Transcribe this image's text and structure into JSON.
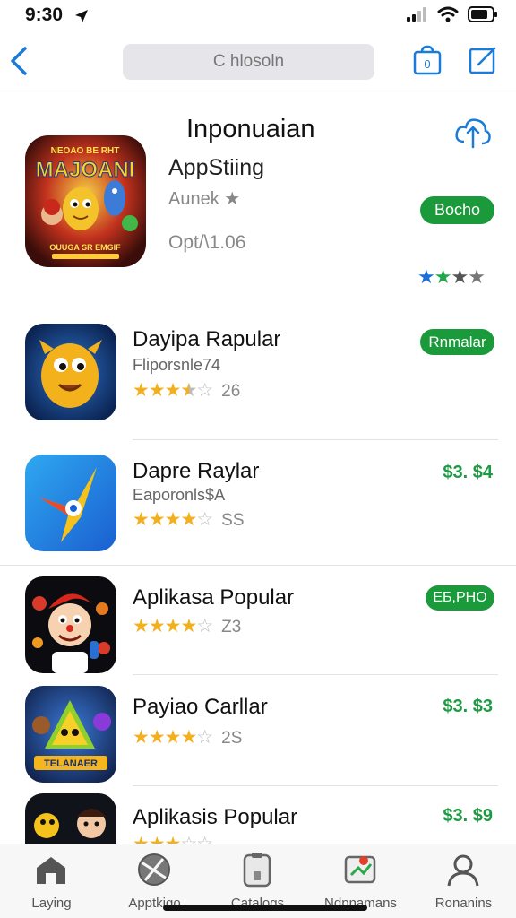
{
  "status": {
    "time": "9:30"
  },
  "nav": {
    "search_placeholder": "C hlosoln",
    "bag_badge": "0"
  },
  "featured": {
    "heading": "Inponuaian",
    "app_name": "AppStiing",
    "subtitle": "Aunek ★",
    "version": "Opt/\\1.06",
    "button_label": "Bocho",
    "rating_stars": [
      "blue",
      "green",
      "gray",
      "gray"
    ],
    "icon_text_top": "NEOAO BE RHT",
    "icon_text_big": "MAJOANI",
    "icon_text_bottom": "OUUGA SR EMGIF"
  },
  "apps": [
    {
      "title": "Dayipa Rapular",
      "subtitle": "Fliporsnle74",
      "rating": 3.5,
      "count": "26",
      "action": "Rnmalar",
      "action_type": "button"
    },
    {
      "title": "Dapre Raylar",
      "subtitle": "Eaporonls$A",
      "rating": 4,
      "count": "SS",
      "action": "$3. $4",
      "action_type": "price"
    },
    {
      "title": "Aplikasa Popular",
      "subtitle": "",
      "rating": 4,
      "count": "Z3",
      "action": "EБ,PHO",
      "action_type": "button"
    },
    {
      "title": "Payiao Carllar",
      "subtitle": "",
      "rating": 4,
      "count": "2S",
      "action": "$3. $3",
      "action_type": "price",
      "icon_text": "TELANAER"
    },
    {
      "title": "Aplikasis Popular",
      "subtitle": "",
      "rating": 3,
      "count": "",
      "action": "$3. $9",
      "action_type": "price"
    }
  ],
  "tabs": [
    {
      "label": "Laying",
      "icon": "home-icon"
    },
    {
      "label": "Apptkigo",
      "icon": "globe-icon"
    },
    {
      "label": "Catalogs",
      "icon": "phone-icon"
    },
    {
      "label": "Ndpnamans",
      "icon": "map-icon"
    },
    {
      "label": "Ronanins",
      "icon": "person-icon"
    }
  ],
  "colors": {
    "accent": "#1a7bd8",
    "green": "#1a9a3b",
    "star": "#f2b01e"
  }
}
